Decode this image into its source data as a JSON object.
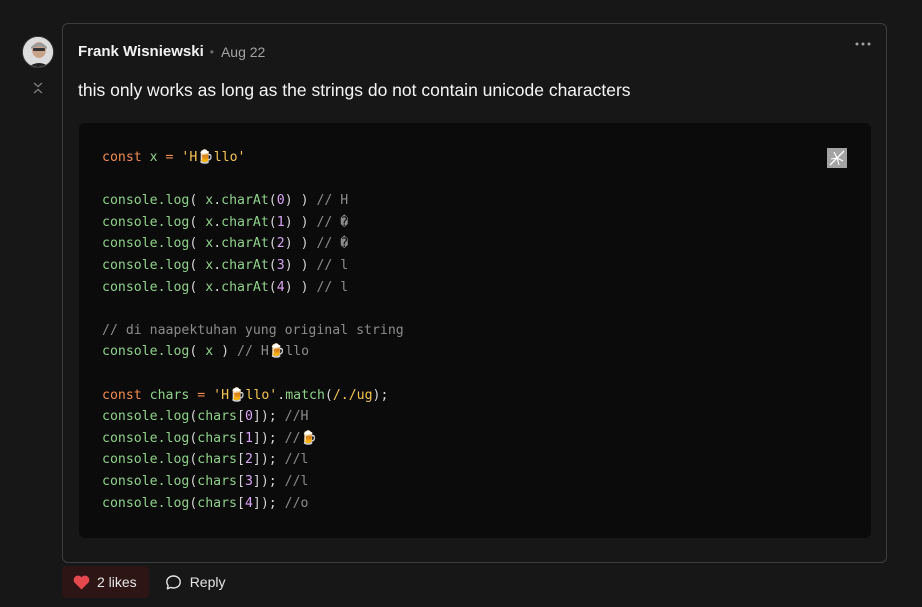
{
  "comment": {
    "author": "Frank Wisniewski",
    "separator": "•",
    "date": "Aug 22",
    "text": "this only works as long as the strings do not contain unicode characters"
  },
  "code_lines": [
    [
      [
        "kw",
        "const "
      ],
      [
        "var",
        "x"
      ],
      [
        "kw",
        " = "
      ],
      [
        "str",
        "'H🍺llo'"
      ]
    ],
    [],
    [
      [
        "fn",
        "console.log"
      ],
      [
        "pn",
        "( "
      ],
      [
        "var",
        "x"
      ],
      [
        "pn",
        "."
      ],
      [
        "fn",
        "charAt"
      ],
      [
        "pn",
        "("
      ],
      [
        "num",
        "0"
      ],
      [
        "pn",
        ") ) "
      ],
      [
        "cm",
        "// H"
      ]
    ],
    [
      [
        "fn",
        "console.log"
      ],
      [
        "pn",
        "( "
      ],
      [
        "var",
        "x"
      ],
      [
        "pn",
        "."
      ],
      [
        "fn",
        "charAt"
      ],
      [
        "pn",
        "("
      ],
      [
        "num",
        "1"
      ],
      [
        "pn",
        ") ) "
      ],
      [
        "cm",
        "// �"
      ]
    ],
    [
      [
        "fn",
        "console.log"
      ],
      [
        "pn",
        "( "
      ],
      [
        "var",
        "x"
      ],
      [
        "pn",
        "."
      ],
      [
        "fn",
        "charAt"
      ],
      [
        "pn",
        "("
      ],
      [
        "num",
        "2"
      ],
      [
        "pn",
        ") ) "
      ],
      [
        "cm",
        "// �"
      ]
    ],
    [
      [
        "fn",
        "console.log"
      ],
      [
        "pn",
        "( "
      ],
      [
        "var",
        "x"
      ],
      [
        "pn",
        "."
      ],
      [
        "fn",
        "charAt"
      ],
      [
        "pn",
        "("
      ],
      [
        "num",
        "3"
      ],
      [
        "pn",
        ") ) "
      ],
      [
        "cm",
        "// l"
      ]
    ],
    [
      [
        "fn",
        "console.log"
      ],
      [
        "pn",
        "( "
      ],
      [
        "var",
        "x"
      ],
      [
        "pn",
        "."
      ],
      [
        "fn",
        "charAt"
      ],
      [
        "pn",
        "("
      ],
      [
        "num",
        "4"
      ],
      [
        "pn",
        ") ) "
      ],
      [
        "cm",
        "// l"
      ]
    ],
    [],
    [
      [
        "cm",
        "// di naapektuhan yung original string"
      ]
    ],
    [
      [
        "fn",
        "console.log"
      ],
      [
        "pn",
        "( "
      ],
      [
        "var",
        "x"
      ],
      [
        "pn",
        " ) "
      ],
      [
        "cm",
        "// H🍺llo"
      ]
    ],
    [],
    [
      [
        "kw",
        "const "
      ],
      [
        "var",
        "chars"
      ],
      [
        "kw",
        " = "
      ],
      [
        "str",
        "'H🍺llo'"
      ],
      [
        "pn",
        "."
      ],
      [
        "fn",
        "match"
      ],
      [
        "pn",
        "("
      ],
      [
        "str",
        "/./ug"
      ],
      [
        "pn",
        ");"
      ]
    ],
    [
      [
        "fn",
        "console.log"
      ],
      [
        "pn",
        "("
      ],
      [
        "var",
        "chars"
      ],
      [
        "pn",
        "["
      ],
      [
        "num",
        "0"
      ],
      [
        "pn",
        "]); "
      ],
      [
        "cm",
        "//H"
      ]
    ],
    [
      [
        "fn",
        "console.log"
      ],
      [
        "pn",
        "("
      ],
      [
        "var",
        "chars"
      ],
      [
        "pn",
        "["
      ],
      [
        "num",
        "1"
      ],
      [
        "pn",
        "]); "
      ],
      [
        "cm",
        "//🍺"
      ]
    ],
    [
      [
        "fn",
        "console.log"
      ],
      [
        "pn",
        "("
      ],
      [
        "var",
        "chars"
      ],
      [
        "pn",
        "["
      ],
      [
        "num",
        "2"
      ],
      [
        "pn",
        "]); "
      ],
      [
        "cm",
        "//l"
      ]
    ],
    [
      [
        "fn",
        "console.log"
      ],
      [
        "pn",
        "("
      ],
      [
        "var",
        "chars"
      ],
      [
        "pn",
        "["
      ],
      [
        "num",
        "3"
      ],
      [
        "pn",
        "]); "
      ],
      [
        "cm",
        "//l"
      ]
    ],
    [
      [
        "fn",
        "console.log"
      ],
      [
        "pn",
        "("
      ],
      [
        "var",
        "chars"
      ],
      [
        "pn",
        "["
      ],
      [
        "num",
        "4"
      ],
      [
        "pn",
        "]); "
      ],
      [
        "cm",
        "//o"
      ]
    ]
  ],
  "actions": {
    "like_label": "2 likes",
    "reply_label": "Reply"
  },
  "colors": {
    "heart": "#e5484d",
    "keyword": "#f28c50",
    "function": "#8fd18a",
    "string": "#f5c451",
    "number": "#d8a4f5",
    "comment": "#8b8b8b"
  },
  "icons": {
    "avatar": "user-avatar",
    "collapse": "chevrons-collapse-icon",
    "more": "ellipsis-icon",
    "copy": "copy-icon",
    "like": "heart-icon",
    "reply": "speech-bubble-icon"
  }
}
